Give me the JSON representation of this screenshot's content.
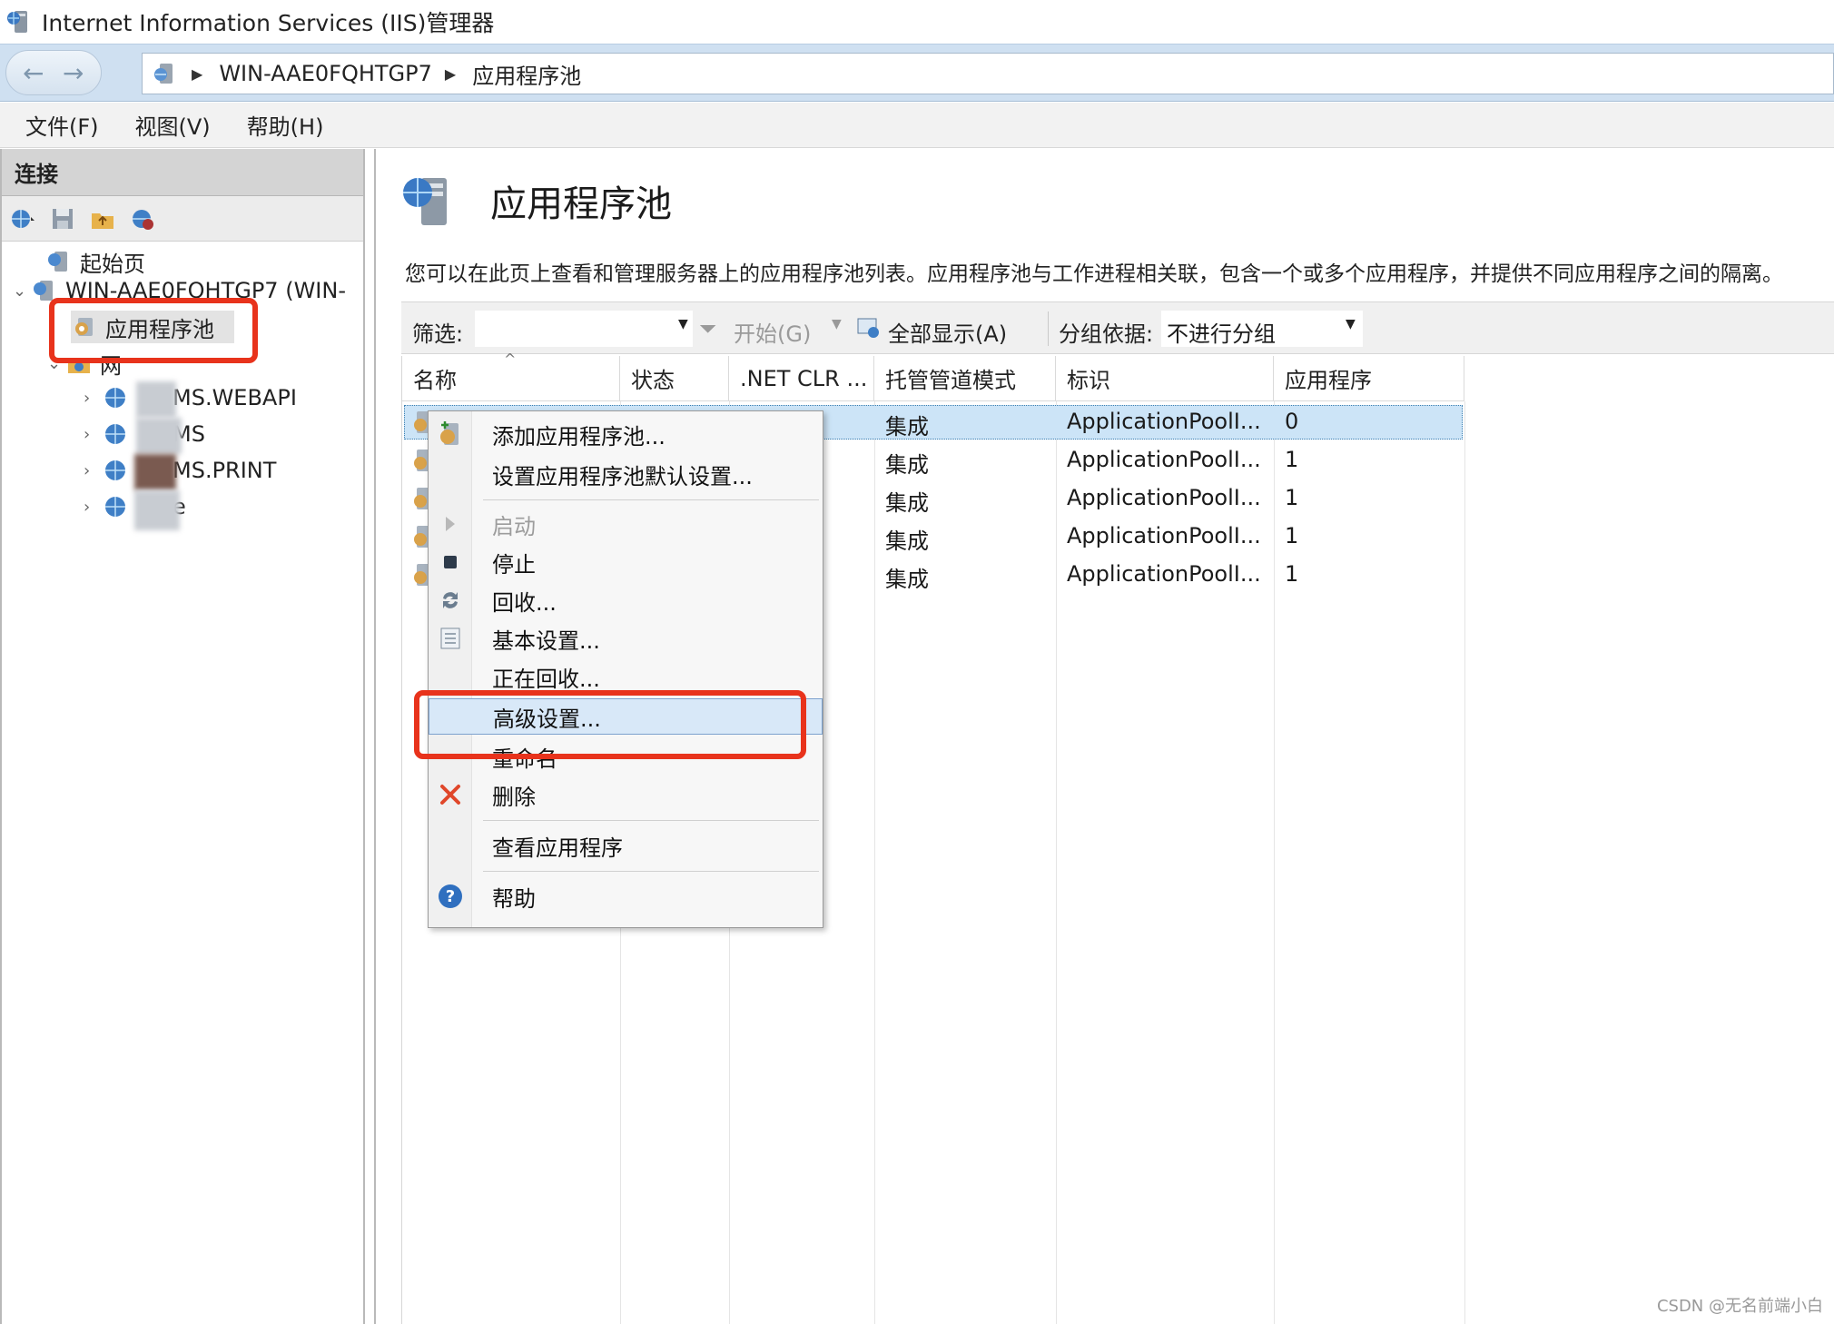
{
  "window": {
    "title": "Internet Information Services (IIS)管理器"
  },
  "address": {
    "server": "WIN-AAE0FQHTGP7",
    "page": "应用程序池"
  },
  "menu": [
    "文件(F)",
    "视图(V)",
    "帮助(H)"
  ],
  "left_panel": {
    "header": "连接",
    "tree": {
      "start_page": "起始页",
      "server": "WIN-AAE0FQHTGP7 (WIN-",
      "app_pools": "应用程序池",
      "sites": "网",
      "site1": "MS.WEBAPI",
      "site2": "MS",
      "site3": "MS.PRINT",
      "site4": "e"
    }
  },
  "main": {
    "title": "应用程序池",
    "description": "您可以在此页上查看和管理服务器上的应用程序池列表。应用程序池与工作进程相关联，包含一个或多个应用程序，并提供不同应用程序之间的隔离。",
    "filter": {
      "label": "筛选:",
      "start": "开始(G)",
      "show_all": "全部显示(A)",
      "group_by_label": "分组依据:",
      "group_by_value": "不进行分组"
    },
    "columns": [
      "名称",
      "状态",
      ".NET CLR ...",
      "托管管道模式",
      "标识",
      "应用程序"
    ],
    "rows": [
      {
        "mode": "集成",
        "identity": "ApplicationPoolI...",
        "apps": "0"
      },
      {
        "mode": "集成",
        "identity": "ApplicationPoolI...",
        "apps": "1"
      },
      {
        "mode": "集成",
        "identity": "ApplicationPoolI...",
        "apps": "1"
      },
      {
        "mode": "集成",
        "identity": "ApplicationPoolI...",
        "apps": "1"
      },
      {
        "mode": "集成",
        "identity": "ApplicationPoolI...",
        "apps": "1"
      }
    ]
  },
  "context_menu": {
    "add": "添加应用程序池...",
    "defaults": "设置应用程序池默认设置...",
    "start": "启动",
    "stop": "停止",
    "recycle": "回收...",
    "basic": "基本设置...",
    "recycling": "正在回收...",
    "advanced": "高级设置...",
    "rename": "重命名",
    "delete": "删除",
    "view_apps": "查看应用程序",
    "help": "帮助"
  },
  "watermark": "CSDN @无名前端小白",
  "colors": {
    "highlight": "#e8331c",
    "selection": "#cce4f7",
    "address_bg": "#cfe0f1"
  }
}
